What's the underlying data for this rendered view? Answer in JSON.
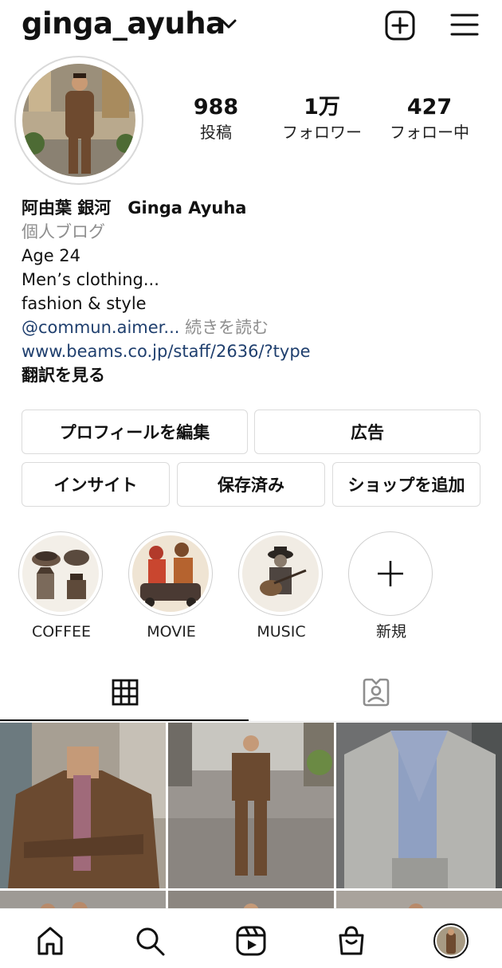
{
  "header": {
    "username": "ginga_ayuha",
    "icons": {
      "dropdown": "chevron-down-icon",
      "new_post": "plus-square-icon",
      "menu": "hamburger-menu-icon"
    }
  },
  "profile": {
    "stats": [
      {
        "value": "988",
        "label": "投稿"
      },
      {
        "value": "1万",
        "label": "フォロワー"
      },
      {
        "value": "427",
        "label": "フォロー中"
      }
    ],
    "bio": {
      "name": "阿由葉 銀河　Ginga Ayuha",
      "category": "個人ブログ",
      "lines": [
        "Age 24",
        "Men’s clothing...",
        "fashion & style"
      ],
      "mention": "@commun.aimer...",
      "more": " 続きを読む",
      "website": "www.beams.co.jp/staff/2636/?type",
      "translate": "翻訳を見る"
    }
  },
  "buttons": {
    "edit_profile": "プロフィールを編集",
    "ads": "広告",
    "insights": "インサイト",
    "saved": "保存済み",
    "add_shop": "ショップを追加"
  },
  "highlights": [
    {
      "label": "COFFEE"
    },
    {
      "label": "MOVIE"
    },
    {
      "label": "MUSIC"
    },
    {
      "label": "新規"
    }
  ],
  "tabs": {
    "icons": [
      "grid-icon",
      "tagged-person-icon"
    ]
  },
  "bottom_nav": {
    "icons": [
      "home-icon",
      "search-icon",
      "reels-icon",
      "shop-icon",
      "profile-avatar"
    ]
  },
  "colors": {
    "link": "#1f3f6e",
    "muted": "#8e8e8e",
    "border": "#dbdbdb"
  }
}
